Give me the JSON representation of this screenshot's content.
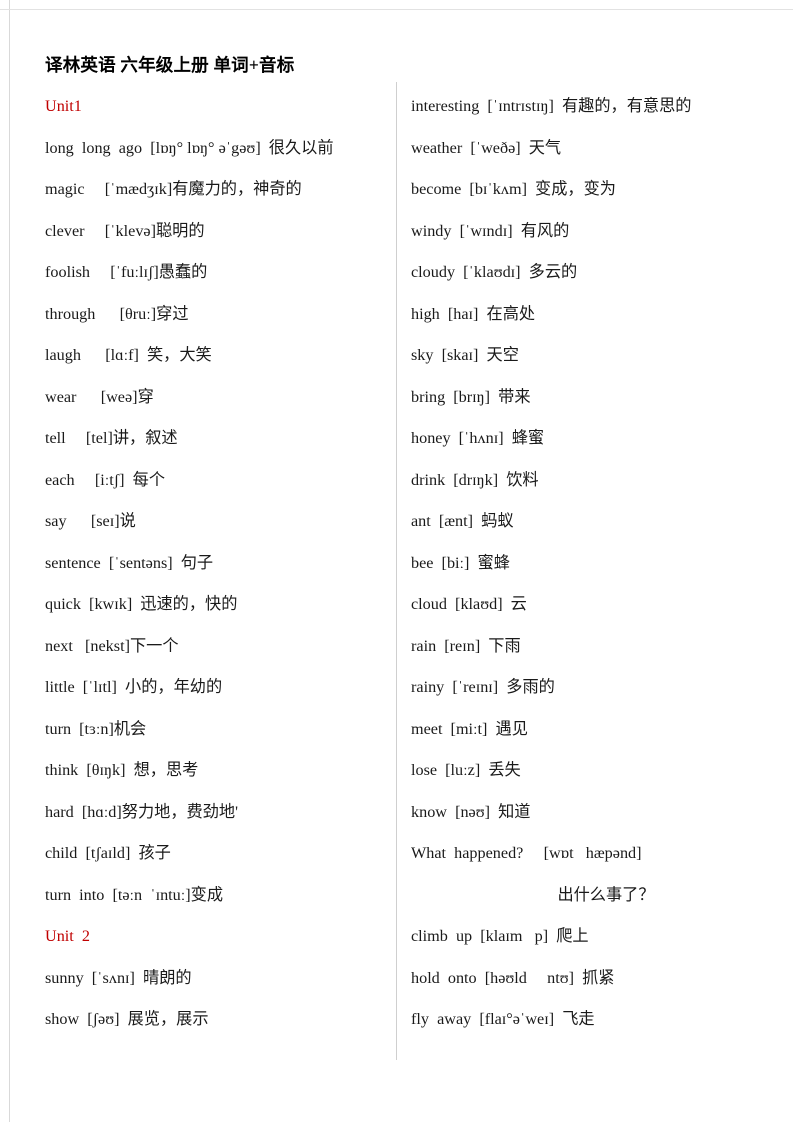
{
  "document": {
    "title": "译林英语 六年级上册 单词+音标"
  },
  "columns": {
    "left": [
      {
        "type": "unit",
        "text": "Unit1"
      },
      {
        "type": "entry",
        "text": "long  long  ago  [lɒŋ° lɒŋ° əˈgəʊ]  很久以前"
      },
      {
        "type": "entry",
        "text": "magic     [ˈmædʒɪk]有魔力的，神奇的"
      },
      {
        "type": "entry",
        "text": "clever     [ˈklevə]聪明的"
      },
      {
        "type": "entry",
        "text": "foolish     [ˈfuːlɪʃ]愚蠢的"
      },
      {
        "type": "entry",
        "text": "through      [θruː]穿过"
      },
      {
        "type": "entry",
        "text": "laugh      [lɑːf]  笑，大笑"
      },
      {
        "type": "entry",
        "text": "wear      [weə]穿"
      },
      {
        "type": "entry",
        "text": "tell     [tel]讲，叙述"
      },
      {
        "type": "entry",
        "text": "each     [iːtʃ]  每个"
      },
      {
        "type": "entry",
        "text": "say      [seɪ]说"
      },
      {
        "type": "entry",
        "text": "sentence  [ˈsentəns]  句子"
      },
      {
        "type": "entry",
        "text": "quick  [kwɪk]  迅速的，快的"
      },
      {
        "type": "entry",
        "text": "next   [nekst]下一个"
      },
      {
        "type": "entry",
        "text": "little  [ˈlɪtl]  小的，年幼的"
      },
      {
        "type": "entry",
        "text": "turn  [tɜːn]机会"
      },
      {
        "type": "entry",
        "text": "think  [θɪŋk]  想，思考"
      },
      {
        "type": "entry",
        "text": "hard  [hɑːd]努力地，费劲地'"
      },
      {
        "type": "entry",
        "text": "child  [tʃaɪld]  孩子"
      },
      {
        "type": "entry",
        "text": "turn  into  [təːn  ˈɪntuː]变成"
      },
      {
        "type": "unit",
        "text": "Unit  2"
      },
      {
        "type": "entry",
        "text": "sunny  [ˈsʌnɪ]  晴朗的"
      },
      {
        "type": "entry",
        "text": "show  [ʃəʊ]  展览，展示"
      }
    ],
    "right": [
      {
        "type": "entry",
        "text": "interesting  [ˈɪntrɪstɪŋ]  有趣的，有意思的"
      },
      {
        "type": "entry",
        "text": "weather  [ˈweðə]  天气"
      },
      {
        "type": "entry",
        "text": "become  [bɪˈkʌm]  变成，变为"
      },
      {
        "type": "entry",
        "text": "windy  [ˈwɪndɪ]  有风的"
      },
      {
        "type": "entry",
        "text": "cloudy  [ˈklaʊdɪ]  多云的"
      },
      {
        "type": "entry",
        "text": "high  [haɪ]  在高处"
      },
      {
        "type": "entry",
        "text": "sky  [skaɪ]  天空"
      },
      {
        "type": "entry",
        "text": "bring  [brɪŋ]  带来"
      },
      {
        "type": "entry",
        "text": "honey  [ˈhʌnɪ]  蜂蜜"
      },
      {
        "type": "entry",
        "text": "drink  [drɪŋk]  饮料"
      },
      {
        "type": "entry",
        "text": "ant  [ænt]  蚂蚁"
      },
      {
        "type": "entry",
        "text": "bee  [biː]  蜜蜂"
      },
      {
        "type": "entry",
        "text": "cloud  [klaʊd]  云"
      },
      {
        "type": "entry",
        "text": "rain  [reɪn]  下雨"
      },
      {
        "type": "entry",
        "text": "rainy  [ˈreɪnɪ]  多雨的"
      },
      {
        "type": "entry",
        "text": "meet  [miːt]  遇见"
      },
      {
        "type": "entry",
        "text": "lose  [luːz]  丢失"
      },
      {
        "type": "entry",
        "text": "know  [nəʊ]  知道"
      },
      {
        "type": "entry",
        "text": "What  happened?     [wɒt   hæpənd]"
      },
      {
        "type": "cont",
        "text": "出什么事了？"
      },
      {
        "type": "entry",
        "text": "climb  up  [klaɪm   p]  爬上"
      },
      {
        "type": "entry",
        "text": "hold  onto  [həʊld     ntʊ]  抓紧"
      },
      {
        "type": "entry",
        "text": "fly  away  [flaɪ°əˈweɪ]  飞走"
      }
    ]
  },
  "colors": {
    "unit_heading": "#c00000",
    "body_text": "#1a1a1a",
    "divider": "#cfcfcf",
    "page_background": "#ffffff"
  }
}
